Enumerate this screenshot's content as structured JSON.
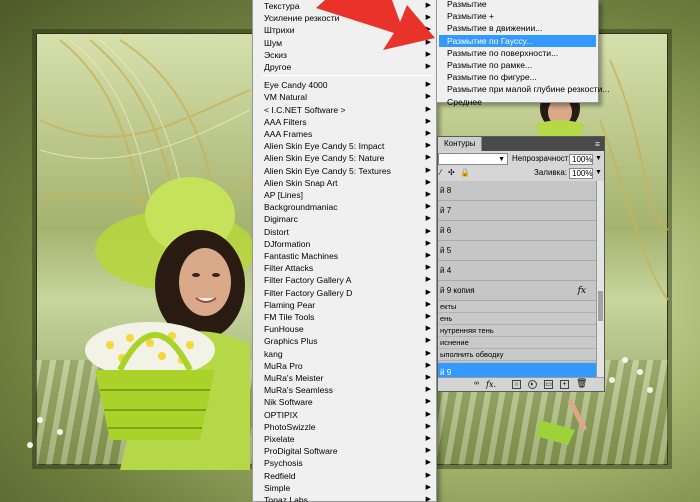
{
  "main_menu": {
    "items": [
      {
        "label": "Текстура",
        "submenu": true
      },
      {
        "label": "Усиление резкости",
        "submenu": true
      },
      {
        "label": "Штрихи",
        "submenu": true
      },
      {
        "label": "Шум",
        "submenu": true
      },
      {
        "label": "Эскиз",
        "submenu": true
      },
      {
        "label": "Другое",
        "submenu": true
      },
      {
        "label": "Eye Candy 4000",
        "submenu": true
      },
      {
        "label": "VM Natural",
        "submenu": true
      },
      {
        "label": "< I.C.NET Software >",
        "submenu": true
      },
      {
        "label": "AAA Filters",
        "submenu": true
      },
      {
        "label": "AAA Frames",
        "submenu": true
      },
      {
        "label": "Alien Skin Eye Candy 5: Impact",
        "submenu": true
      },
      {
        "label": "Alien Skin Eye Candy 5: Nature",
        "submenu": true
      },
      {
        "label": "Alien Skin Eye Candy 5: Textures",
        "submenu": true
      },
      {
        "label": "Alien Skin Snap Art",
        "submenu": true
      },
      {
        "label": "AP [Lines]",
        "submenu": true
      },
      {
        "label": "Backgroundmaniac",
        "submenu": true
      },
      {
        "label": "Digimarc",
        "submenu": true
      },
      {
        "label": "Distort",
        "submenu": true
      },
      {
        "label": "DJformation",
        "submenu": true
      },
      {
        "label": "Fantastic Machines",
        "submenu": true
      },
      {
        "label": "Filter Attacks",
        "submenu": true
      },
      {
        "label": "Filter Factory Gallery A",
        "submenu": true
      },
      {
        "label": "Filter Factory Gallery D",
        "submenu": true
      },
      {
        "label": "Flaming Pear",
        "submenu": true
      },
      {
        "label": "FM Tile Tools",
        "submenu": true
      },
      {
        "label": "FunHouse",
        "submenu": true
      },
      {
        "label": "Graphics Plus",
        "submenu": true
      },
      {
        "label": "kang",
        "submenu": true
      },
      {
        "label": "MuRa Pro",
        "submenu": true
      },
      {
        "label": "MuRa's Meister",
        "submenu": true
      },
      {
        "label": "MuRa's Seamless",
        "submenu": true
      },
      {
        "label": "Nik Software",
        "submenu": true
      },
      {
        "label": "OPTIPIX",
        "submenu": true
      },
      {
        "label": "PhotoSwizzle",
        "submenu": true
      },
      {
        "label": "Pixelate",
        "submenu": true
      },
      {
        "label": "ProDigital Software",
        "submenu": true
      },
      {
        "label": "Psychosis",
        "submenu": true
      },
      {
        "label": "Redfield",
        "submenu": true
      },
      {
        "label": "Simple",
        "submenu": true
      },
      {
        "label": "Topaz Labs",
        "submenu": true
      }
    ]
  },
  "blur_submenu": {
    "items": [
      {
        "label": "Размытие"
      },
      {
        "label": "Размытие +"
      },
      {
        "label": "Размытие в движении..."
      },
      {
        "label": "Размытие по Гауссу...",
        "highlighted": true
      },
      {
        "label": "Размытие по поверхности..."
      },
      {
        "label": "Размытие по рамке..."
      },
      {
        "label": "Размытие по фигуре..."
      },
      {
        "label": "Размытие при малой глубине резкости..."
      },
      {
        "label": "Среднее"
      }
    ]
  },
  "layers_panel": {
    "tab_label": "Контуры",
    "opacity_label": "Непрозрачность:",
    "opacity_value": "100%",
    "fill_label": "Заливка:",
    "fill_value": "100%",
    "layers": [
      {
        "label": "й 8"
      },
      {
        "label": "й 7"
      },
      {
        "label": "й 6"
      },
      {
        "label": "й 5"
      },
      {
        "label": "й 4"
      },
      {
        "label": "й 9 копия",
        "fx": "fx"
      }
    ],
    "effects": [
      {
        "label": "екты"
      },
      {
        "label": "ень"
      },
      {
        "label": "нутренняя тень"
      },
      {
        "label": "иснение"
      },
      {
        "label": "ыполнить обводку"
      }
    ],
    "selected_layer": {
      "label": "й 9"
    },
    "bottom_fx": "fx."
  },
  "colors": {
    "highlight": "#3399ff",
    "arrow": "#e8322a"
  }
}
